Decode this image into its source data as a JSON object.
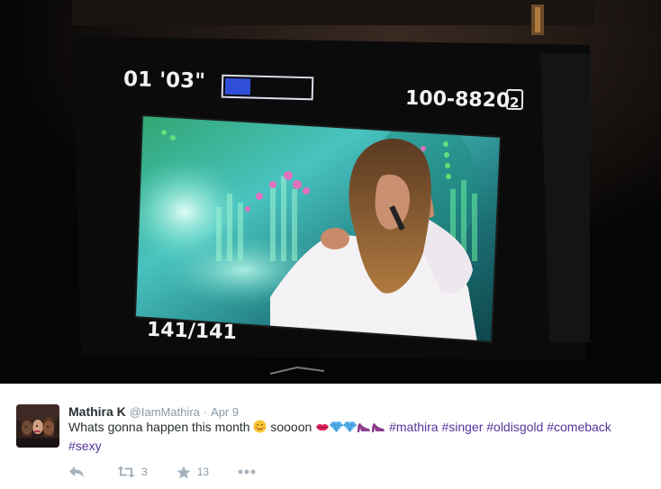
{
  "photo": {
    "time_code": "01 '03\"",
    "file_number": "100-8820",
    "card_slot": "2",
    "frame_counter": "141/141",
    "exposure_bar_fill": 0.3
  },
  "tweet": {
    "author_name": "Mathira K",
    "author_handle": "@IamMathira",
    "separator": "·",
    "date": "Apr 9",
    "text_start": "Whats gonna happen this month ",
    "text_middle": " soooon ",
    "hashtags": [
      "#mathira",
      "#singer",
      "#oldisgold",
      "#comeback",
      "#sexy"
    ]
  },
  "actions": {
    "reply_icon": "reply-icon",
    "retweet_icon": "retweet-icon",
    "retweet_count": "3",
    "favorite_icon": "star-icon",
    "favorite_count": "13",
    "more_icon": "more-icon"
  },
  "colors": {
    "hashtag": "#55339b",
    "name": "#292f33",
    "muted": "#8899a6",
    "icon": "#a6b2bc"
  }
}
